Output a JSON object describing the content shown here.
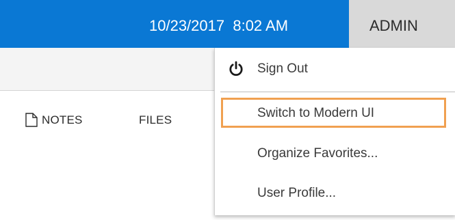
{
  "header": {
    "date": "10/23/2017",
    "time": "8:02 AM",
    "user_button": "ADMIN"
  },
  "toolbar": {
    "notes_label": "NOTES",
    "files_label": "FILES"
  },
  "user_menu": {
    "items": [
      {
        "label": "Sign Out",
        "icon": "power-icon"
      },
      {
        "label": "Switch to Modern UI",
        "highlighted": true
      },
      {
        "label": "Organize Favorites..."
      },
      {
        "label": "User Profile..."
      }
    ]
  },
  "colors": {
    "header_bg": "#0a78d4",
    "admin_bg": "#d9d9d9",
    "highlight_border": "#f0a050"
  }
}
